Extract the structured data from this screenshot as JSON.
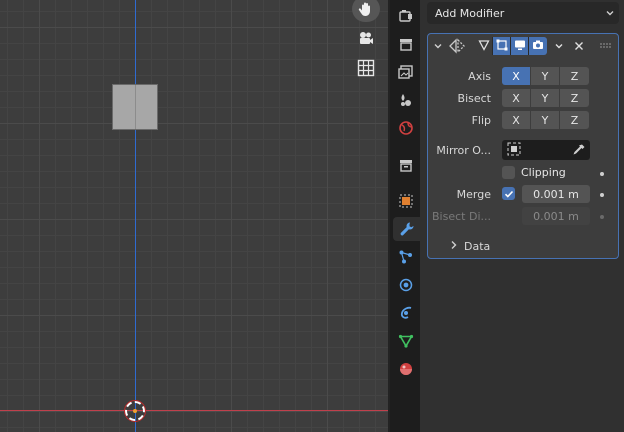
{
  "panel": {
    "add_modifier_label": "Add Modifier"
  },
  "modifier": {
    "rows": {
      "axis": {
        "label": "Axis",
        "x": "X",
        "y": "Y",
        "z": "Z"
      },
      "bisect": {
        "label": "Bisect",
        "x": "X",
        "y": "Y",
        "z": "Z"
      },
      "flip": {
        "label": "Flip",
        "x": "X",
        "y": "Y",
        "z": "Z"
      }
    },
    "mirror_object_label": "Mirror O...",
    "clipping_label": "Clipping",
    "merge_label": "Merge",
    "merge_value": "0.001 m",
    "bisect_distance_label": "Bisect Di...",
    "bisect_distance_value": "0.001 m",
    "data_subpanel_label": "Data"
  },
  "state": {
    "axis_x_enabled": true,
    "clipping_enabled": false,
    "merge_enabled": true
  },
  "colors": {
    "accent": "#4772b3",
    "z_axis_line": "#2f6bd1",
    "x_axis_line": "#c0404c",
    "viewport_bg": "#3d3d3d",
    "panel_bg": "#303030"
  },
  "icons": {
    "viewport": [
      "hand-icon",
      "camera-icon",
      "grid-icon"
    ],
    "tabs": [
      "tool-icon",
      "render-icon",
      "output-icon",
      "view-layer-icon",
      "scene-icon",
      "world-icon",
      "collection-icon",
      "object-icon",
      "modifier-icon",
      "particles-icon",
      "physics-icon",
      "constraints-icon",
      "data-icon",
      "material-icon"
    ]
  }
}
